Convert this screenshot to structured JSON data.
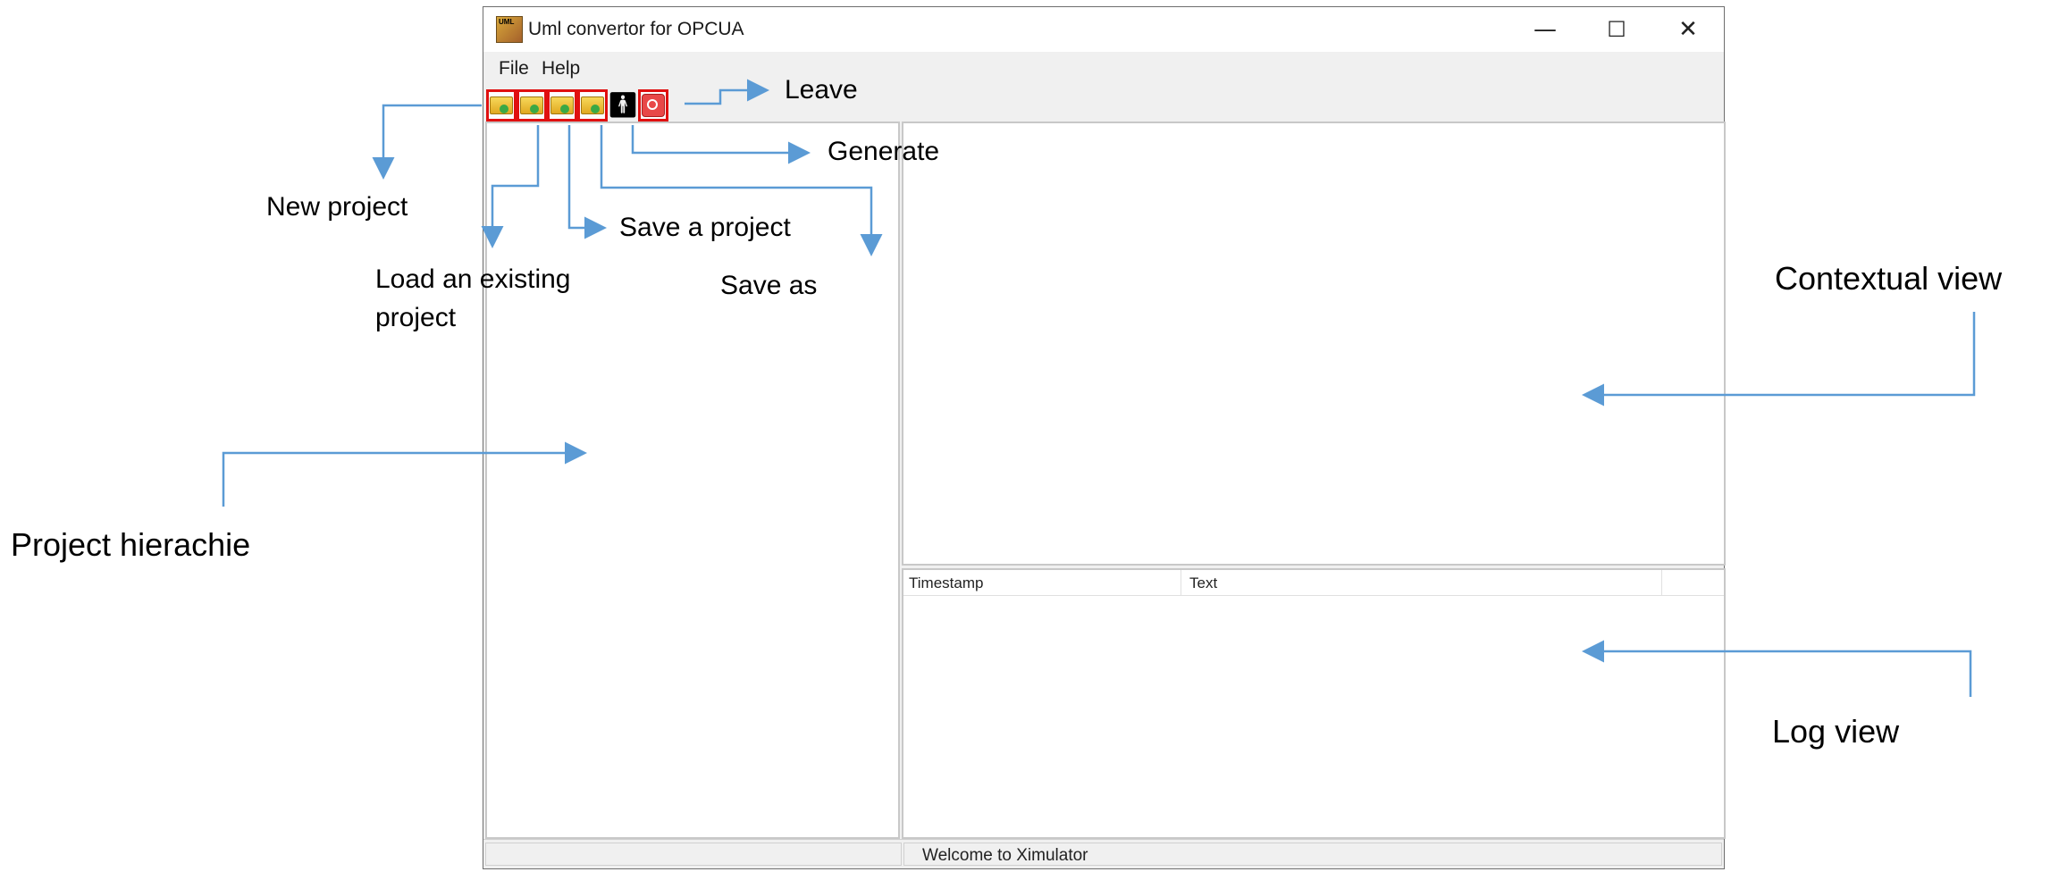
{
  "window": {
    "title": "Uml convertor for OPCUA",
    "controls": {
      "minimize": "—",
      "maximize": "☐",
      "close": "✕"
    }
  },
  "menu": {
    "file": "File",
    "help": "Help"
  },
  "toolbar": {
    "buttons": [
      {
        "name": "new-project",
        "icon": "folder-new-icon"
      },
      {
        "name": "load-project",
        "icon": "folder-open-icon"
      },
      {
        "name": "save-project",
        "icon": "folder-save-icon"
      },
      {
        "name": "save-as",
        "icon": "folder-save-as-icon"
      },
      {
        "name": "generate",
        "icon": "person-icon"
      },
      {
        "name": "leave",
        "icon": "power-icon"
      }
    ]
  },
  "log": {
    "columns": [
      "Timestamp",
      "Text"
    ]
  },
  "status": {
    "text": "Welcome to Ximulator"
  },
  "annotations": {
    "leave": "Leave",
    "generate": "Generate",
    "new_project": "New project",
    "save_project": "Save a project",
    "load_line1": "Load an existing",
    "load_line2": "project",
    "save_as": "Save as",
    "contextual_view": "Contextual view",
    "project_hierarchy": "Project hierachie",
    "log_view": "Log view"
  },
  "colors": {
    "arrow": "#5b9bd5",
    "highlight": "#e01010"
  }
}
